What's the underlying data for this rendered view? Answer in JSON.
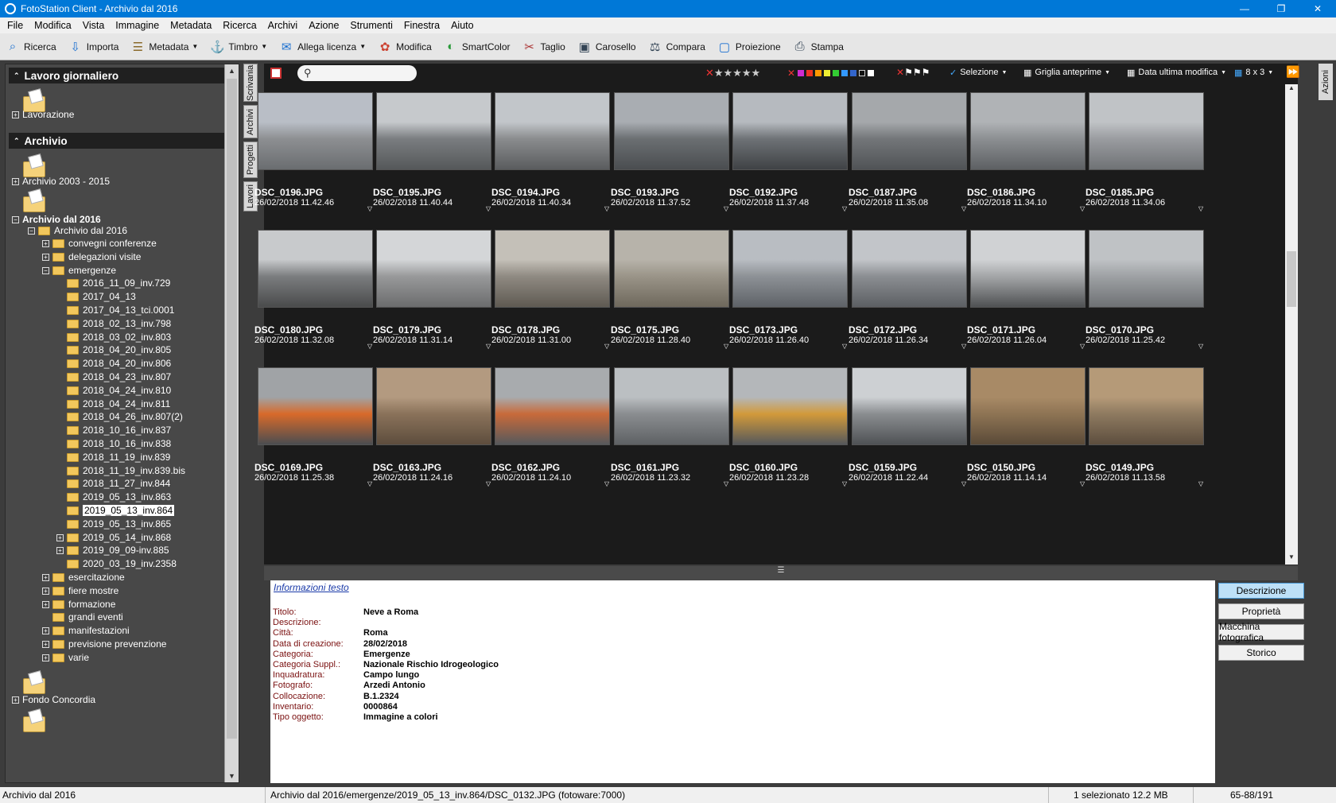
{
  "window": {
    "title": "FotoStation Client - Archivio dal 2016"
  },
  "menu": [
    "File",
    "Modifica",
    "Vista",
    "Immagine",
    "Metadata",
    "Ricerca",
    "Archivi",
    "Azione",
    "Strumenti",
    "Finestra",
    "Aiuto"
  ],
  "toolbar": [
    {
      "label": "Ricerca",
      "icon": "search-icon"
    },
    {
      "label": "Importa",
      "icon": "import-icon"
    },
    {
      "label": "Metadata",
      "icon": "metadata-icon"
    },
    {
      "label": "Timbro",
      "icon": "stamp-icon"
    },
    {
      "label": "Allega licenza",
      "icon": "license-icon"
    },
    {
      "label": "Modifica",
      "icon": "palette-icon"
    },
    {
      "label": "SmartColor",
      "icon": "smartcolor-icon"
    },
    {
      "label": "Taglio",
      "icon": "crop-icon"
    },
    {
      "label": "Carosello",
      "icon": "carousel-icon"
    },
    {
      "label": "Compara",
      "icon": "compare-icon"
    },
    {
      "label": "Proiezione",
      "icon": "projection-icon"
    },
    {
      "label": "Stampa",
      "icon": "print-icon"
    }
  ],
  "sidetabs": [
    "Scrivania",
    "Archivi",
    "Progetti",
    "Lavori"
  ],
  "right_tab": "Azioni",
  "left": {
    "daily_work": "Lavoro giornaliero",
    "lavorazione": "Lavorazione",
    "archive_head": "Archivio",
    "archive_2003": "Archivio 2003 - 2015",
    "archive_2016": "Archivio dal 2016",
    "archive_2016_sub": "Archivio dal 2016",
    "folders_top": [
      "convegni conferenze",
      "delegazioni visite",
      "emergenze"
    ],
    "emergenze_children": [
      "2016_11_09_inv.729",
      "2017_04_13",
      "2017_04_13_tci.0001",
      "2018_02_13_inv.798",
      "2018_03_02_inv.803",
      "2018_04_20_inv.805",
      "2018_04_20_inv.806",
      "2018_04_23_inv.807",
      "2018_04_24_inv.810",
      "2018_04_24_inv.811",
      "2018_04_26_inv.807(2)",
      "2018_10_16_inv.837",
      "2018_10_16_inv.838",
      "2018_11_19_inv.839",
      "2018_11_19_inv.839.bis",
      "2018_11_27_inv.844",
      "2019_05_13_inv.863",
      "2019_05_13_inv.864",
      "2019_05_13_inv.865",
      "2019_05_14_inv.868",
      "2019_09_09-inv.885",
      "2020_03_19_inv.2358"
    ],
    "folders_bottom": [
      "esercitazione",
      "fiere mostre",
      "formazione",
      "grandi eventi",
      "manifestazioni",
      "previsione prevenzione",
      "varie"
    ],
    "fondo": "Fondo Concordia"
  },
  "content_toolbar": {
    "selection": "Selezione",
    "view": "Griglia anteprime",
    "sort": "Data ultima modifica",
    "grid": "8 x 3"
  },
  "images": [
    {
      "name": "DSC_0196.JPG",
      "date": "26/02/2018 11.42.46"
    },
    {
      "name": "DSC_0195.JPG",
      "date": "26/02/2018 11.40.44"
    },
    {
      "name": "DSC_0194.JPG",
      "date": "26/02/2018 11.40.34"
    },
    {
      "name": "DSC_0193.JPG",
      "date": "26/02/2018 11.37.52"
    },
    {
      "name": "DSC_0192.JPG",
      "date": "26/02/2018 11.37.48"
    },
    {
      "name": "DSC_0187.JPG",
      "date": "26/02/2018 11.35.08"
    },
    {
      "name": "DSC_0186.JPG",
      "date": "26/02/2018 11.34.10"
    },
    {
      "name": "DSC_0185.JPG",
      "date": "26/02/2018 11.34.06"
    },
    {
      "name": "DSC_0180.JPG",
      "date": "26/02/2018 11.32.08"
    },
    {
      "name": "DSC_0179.JPG",
      "date": "26/02/2018 11.31.14"
    },
    {
      "name": "DSC_0178.JPG",
      "date": "26/02/2018 11.31.00"
    },
    {
      "name": "DSC_0175.JPG",
      "date": "26/02/2018 11.28.40"
    },
    {
      "name": "DSC_0173.JPG",
      "date": "26/02/2018 11.26.40"
    },
    {
      "name": "DSC_0172.JPG",
      "date": "26/02/2018 11.26.34"
    },
    {
      "name": "DSC_0171.JPG",
      "date": "26/02/2018 11.26.04"
    },
    {
      "name": "DSC_0170.JPG",
      "date": "26/02/2018 11.25.42"
    },
    {
      "name": "DSC_0169.JPG",
      "date": "26/02/2018 11.25.38"
    },
    {
      "name": "DSC_0163.JPG",
      "date": "26/02/2018 11.24.16"
    },
    {
      "name": "DSC_0162.JPG",
      "date": "26/02/2018 11.24.10"
    },
    {
      "name": "DSC_0161.JPG",
      "date": "26/02/2018 11.23.32"
    },
    {
      "name": "DSC_0160.JPG",
      "date": "26/02/2018 11.23.28"
    },
    {
      "name": "DSC_0159.JPG",
      "date": "26/02/2018 11.22.44"
    },
    {
      "name": "DSC_0150.JPG",
      "date": "26/02/2018 11.14.14"
    },
    {
      "name": "DSC_0149.JPG",
      "date": "26/02/2018 11.13.58"
    }
  ],
  "info": {
    "title": "Informazioni testo",
    "rows": [
      {
        "label": "Titolo:",
        "value": "Neve a Roma"
      },
      {
        "label": "Descrizione:",
        "value": ""
      },
      {
        "label": "Città:",
        "value": "Roma"
      },
      {
        "label": "Data di creazione:",
        "value": "28/02/2018"
      },
      {
        "label": "Categoria:",
        "value": "Emergenze"
      },
      {
        "label": "Categoria Suppl.:",
        "value": "Nazionale Rischio Idrogeologico"
      },
      {
        "label": "Inquadratura:",
        "value": "Campo lungo"
      },
      {
        "label": "Fotografo:",
        "value": "Arzedi Antonio"
      },
      {
        "label": "Collocazione:",
        "value": "B.1.2324"
      },
      {
        "label": "Inventario:",
        "value": "0000864"
      },
      {
        "label": "Tipo oggetto:",
        "value": "Immagine a colori"
      }
    ],
    "buttons": [
      "Descrizione",
      "Proprietà",
      "Macchina fotografica",
      "Storico"
    ]
  },
  "status": {
    "archive": "Archivio dal 2016",
    "path": "Archivio dal 2016/emergenze/2019_05_13_inv.864/DSC_0132.JPG (fotoware:7000)",
    "selected": "1 selezionato",
    "size": "12.2 MB",
    "range": "65-88/191"
  },
  "colors": {
    "accent": "#0078d7",
    "grid_bg": "#1b1b1b",
    "panel_bg": "#484848",
    "label_red": "#7a1010"
  }
}
